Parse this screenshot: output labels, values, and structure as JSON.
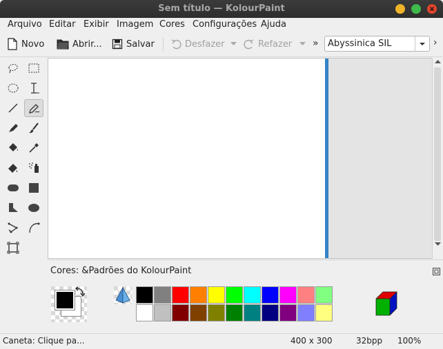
{
  "window": {
    "title": "Sem título  — KolourPaint",
    "controls": {
      "minimize_color": "#f0b428",
      "maximize_color": "#3fb94a",
      "close_color": "#e0452c"
    }
  },
  "menu": {
    "items": [
      "Arquivo",
      "Editar",
      "Exibir",
      "Imagem",
      "Cores",
      "Configurações",
      "Ajuda"
    ]
  },
  "toolbar": {
    "new_label": "Novo",
    "open_label": "Abrir...",
    "save_label": "Salvar",
    "undo_label": "Desfazer",
    "redo_label": "Refazer",
    "overflow": "»",
    "font_select": "Abyssinica SIL",
    "right_overflow": "›"
  },
  "tools": [
    "free-form-selection",
    "rectangular-selection",
    "elliptical-selection",
    "text",
    "line",
    "pen",
    "brush",
    "brush-2",
    "flood-fill",
    "color-picker",
    "color-eraser",
    "spraycan",
    "rounded-rectangle",
    "rectangle",
    "polygon",
    "ellipse",
    "connected-lines",
    "curve",
    "zoom"
  ],
  "selected_tool": "pen",
  "canvas": {
    "background": "#ffffff",
    "edge_color": "#3584c6"
  },
  "palette": {
    "title": "Cores: &Padrões do KolourPaint",
    "foreground": "#000000",
    "background": "#ffffff",
    "row1": [
      "#000000",
      "#808080",
      "#ff0000",
      "#ff8000",
      "#ffff00",
      "#00ff00",
      "#00ffff",
      "#0000ff",
      "#ff00ff",
      "#ff8080",
      "#80ff80"
    ],
    "row2": [
      "#ffffff",
      "#c0c0c0",
      "#800000",
      "#804000",
      "#808000",
      "#008000",
      "#008080",
      "#000080",
      "#800080",
      "#8080ff",
      "#ffff80"
    ]
  },
  "status": {
    "tool_hint": "Caneta: Clique pa...",
    "size": "400 x 300",
    "depth": "32bpp",
    "zoom": "100%"
  }
}
